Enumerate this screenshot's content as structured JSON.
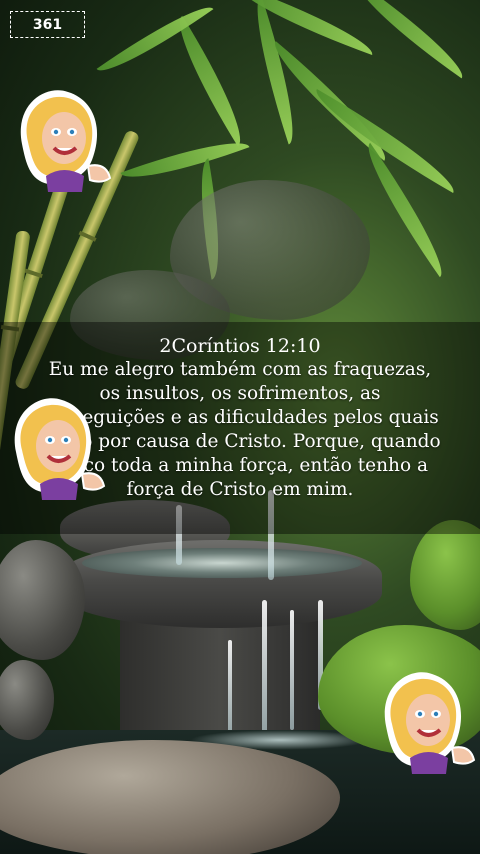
{
  "counter_badge": "361",
  "verse": {
    "reference": "2Coríntios 12:10",
    "text": "Eu me alegro também com as fraquezas, os insultos, os sofrimentos, as perseguições e as dificuldades pelos quais passo por causa de Cristo. Porque, quando perco toda a minha força, então tenho a força de Cristo em mim."
  },
  "stickers": [
    {
      "name": "cartoon-woman-sticker"
    },
    {
      "name": "cartoon-woman-sticker"
    },
    {
      "name": "cartoon-woman-sticker"
    }
  ],
  "colors": {
    "text": "#ffffff",
    "sticker_hair": "#f2c14e",
    "sticker_top": "#7b3fa0",
    "bamboo_leaf": "#7cc043"
  }
}
